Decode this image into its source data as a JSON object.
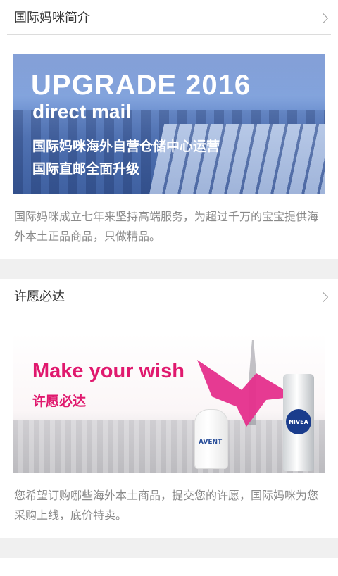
{
  "sections": [
    {
      "title": "国际妈咪简介",
      "banner": {
        "headline": "UPGRADE 2016",
        "subheadline": "direct mail",
        "line1": "国际妈咪海外自营仓储中心运营",
        "line2": "国际直邮全面升级"
      },
      "description": "国际妈咪成立七年来坚持高端服务，为超过千万的宝宝提供海外本土正品商品，只做精品。"
    },
    {
      "title": "许愿必达",
      "banner": {
        "headline": "Make your wish",
        "subheadline": "许愿必达",
        "bottle_brand": "AVENT",
        "can_brand": "NIVEA"
      },
      "description": "您希望订购哪些海外本土商品，提交您的许愿，国际妈咪为您采购上线，底价特卖。"
    }
  ],
  "icons": {
    "chevron": "chevron-right-icon"
  },
  "colors": {
    "accent_pink": "#e0196e",
    "divider": "#dcdcdc",
    "desc_text": "#8a8a8a"
  }
}
